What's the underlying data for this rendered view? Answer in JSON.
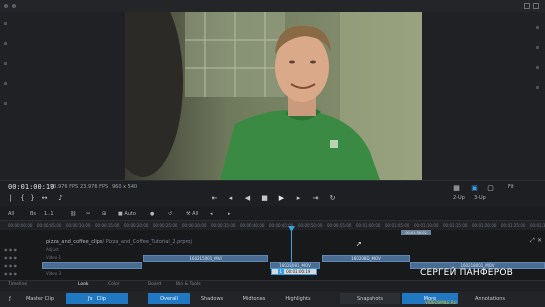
{
  "viewer": {
    "timecode": "00:01:00:19",
    "fps_1": "23.976 FPS",
    "fps_2": "23.976 FPS",
    "resolution": "960 x 540",
    "fit": "Fit",
    "mode_1": "2-Up",
    "mode_2": "3-Up"
  },
  "toolbar": {
    "all": "All",
    "clip_mode": "Bs",
    "range": "1..1",
    "auto": "Auto",
    "all2": "All"
  },
  "ruler": {
    "ticks": [
      "00:00:00:00",
      "00:00:05:00",
      "00:00:10:00",
      "00:00:15:00",
      "00:00:20:00",
      "00:00:25:00",
      "00:00:30:00",
      "00:00:35:00",
      "00:00:40:00",
      "00:00:45:00",
      "00:00:50:00",
      "00:00:55:00",
      "00:01:00:00",
      "00:01:05:00",
      "00:01:10:00",
      "00:01:15:00",
      "00:01:20:00",
      "00:01:25:00",
      "00:01:30:00"
    ]
  },
  "timeline": {
    "clip_title": "pizza_and_coffee_clips",
    "clip_path": "/ Pizza_and_Coffee_Tutorial_2.prproj",
    "track_labels": [
      "Adjust",
      "Video 1",
      "Video 2",
      "Video 3"
    ],
    "clips": [
      {
        "label": "",
        "row": 3
      },
      {
        "label": "160215001_MVI",
        "row": 3
      },
      {
        "label": "16028081_MOV",
        "row": 3
      },
      {
        "label": "160208D_MOV",
        "row": 3
      },
      {
        "label": "160218001_MOV",
        "row": 4
      }
    ],
    "snap_timecode": "00:01:00:19",
    "snap_label": "1",
    "marker": "00:01:56:02"
  },
  "tabs": [
    "Timeline",
    "Look",
    "Color",
    "Board",
    "Bin & Tools"
  ],
  "active_tab": "Look",
  "bottombar": {
    "master_clip": "Master Clip",
    "clip": "Clip",
    "overall": "Overall",
    "shadows": "Shadows",
    "midtones": "Midtones",
    "highlights": "Highlights",
    "snapshots": "Snapshots",
    "more": "More",
    "annotations": "Annotations"
  },
  "watermark": {
    "name": "СЕРГЕЙ ПАНФЕРОВ",
    "site": "VIDEOSMILE.RU"
  },
  "colors": {
    "accent": "#1f78c1",
    "playhead": "#3aa0e0",
    "clip": "#496c93"
  }
}
